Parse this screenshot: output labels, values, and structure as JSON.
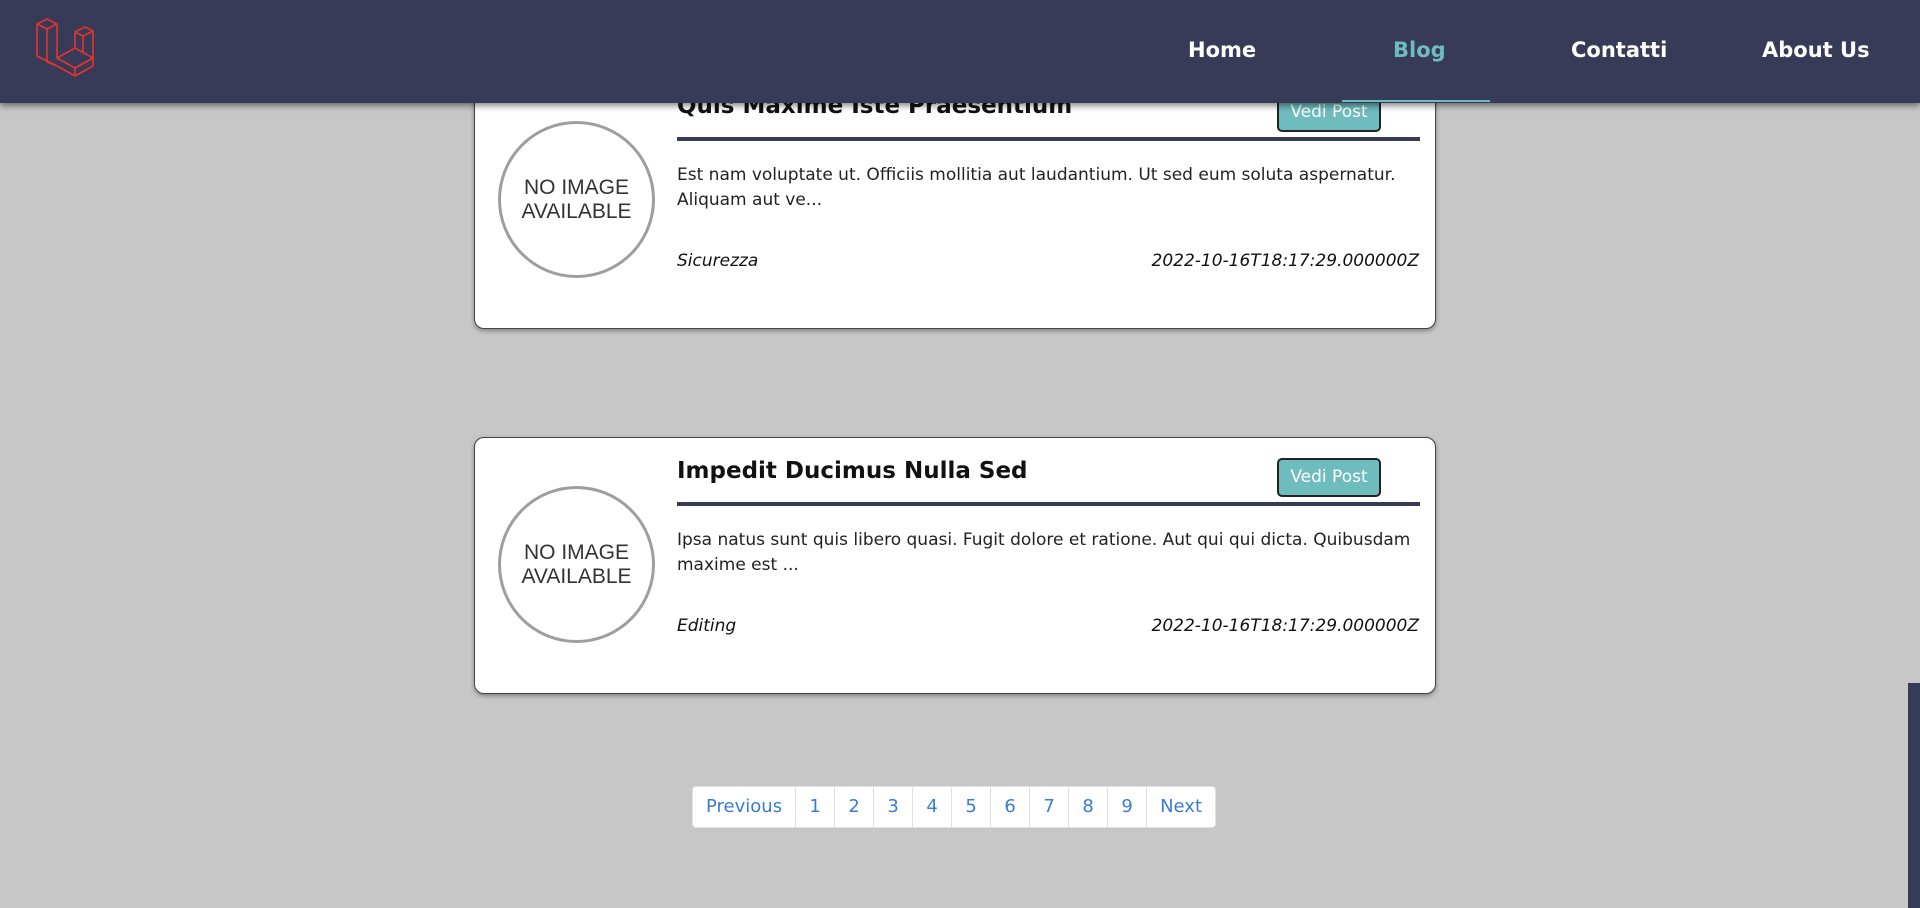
{
  "nav": {
    "logo_icon": "laravel-logo-icon",
    "items": [
      {
        "label": "Home"
      },
      {
        "label": "Blog"
      },
      {
        "label": "Contatti"
      },
      {
        "label": "About Us"
      }
    ],
    "active": "Blog",
    "active_color": "#6fbcbf",
    "bg_color": "#383b58"
  },
  "posts": [
    {
      "title": "Quis Maxime Iste Praesentium",
      "button_label": "Vedi Post",
      "image_text_line1": "NO IMAGE",
      "image_text_line2": "AVAILABLE",
      "excerpt": "Est nam voluptate ut. Officiis mollitia aut laudantium. Ut sed eum soluta aspernatur. Aliquam aut ve...",
      "category": "Sicurezza",
      "date": "2022-10-16T18:17:29.000000Z"
    },
    {
      "title": "Impedit Ducimus Nulla Sed",
      "button_label": "Vedi Post",
      "image_text_line1": "NO IMAGE",
      "image_text_line2": "AVAILABLE",
      "excerpt": "Ipsa natus sunt quis libero quasi. Fugit dolore et ratione. Aut qui qui dicta. Quibusdam maxime est ...",
      "category": "Editing",
      "date": "2022-10-16T18:17:29.000000Z"
    }
  ],
  "pagination": {
    "previous": "Previous",
    "pages": [
      "1",
      "2",
      "3",
      "4",
      "5",
      "6",
      "7",
      "8",
      "9"
    ],
    "next": "Next"
  },
  "colors": {
    "background": "#c7c7c7",
    "button": "#6fbcbf",
    "link": "#3a7bd5"
  }
}
